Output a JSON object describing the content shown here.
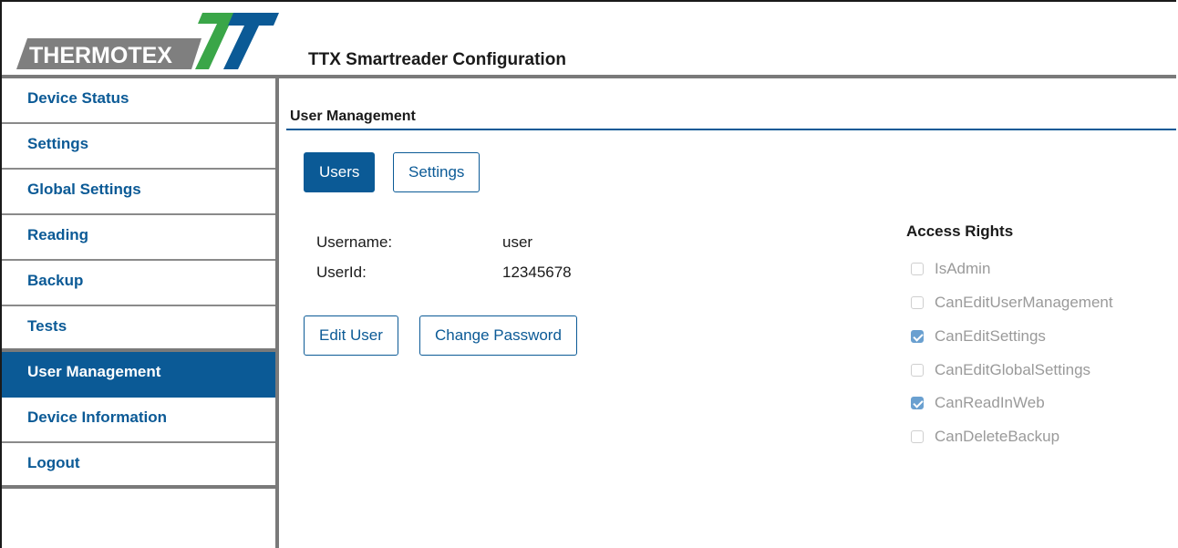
{
  "header": {
    "logo_text": "THERMOTEX",
    "app_title": "TTX Smartreader Configuration"
  },
  "sidebar": {
    "items": [
      {
        "label": "Device Status",
        "active": false
      },
      {
        "label": "Settings",
        "active": false
      },
      {
        "label": "Global Settings",
        "active": false
      },
      {
        "label": "Reading",
        "active": false
      },
      {
        "label": "Backup",
        "active": false
      },
      {
        "label": "Tests",
        "active": false
      },
      {
        "label": "User Management",
        "active": true
      },
      {
        "label": "Device Information",
        "active": false
      },
      {
        "label": "Logout",
        "active": false
      }
    ]
  },
  "main": {
    "section_title": "User Management",
    "tabs": [
      {
        "label": "Users",
        "active": true
      },
      {
        "label": "Settings",
        "active": false
      }
    ],
    "user": {
      "username_label": "Username:",
      "username_value": "user",
      "userid_label": "UserId:",
      "userid_value": "12345678"
    },
    "actions": {
      "edit_user": "Edit User",
      "change_password": "Change Password"
    },
    "access_rights": {
      "title": "Access Rights",
      "items": [
        {
          "label": "IsAdmin",
          "checked": false
        },
        {
          "label": "CanEditUserManagement",
          "checked": false
        },
        {
          "label": "CanEditSettings",
          "checked": true
        },
        {
          "label": "CanEditGlobalSettings",
          "checked": false
        },
        {
          "label": "CanReadInWeb",
          "checked": true
        },
        {
          "label": "CanDeleteBackup",
          "checked": false
        }
      ]
    }
  },
  "colors": {
    "brand_blue": "#0b5a96",
    "logo_green": "#3aa648",
    "logo_gray": "#7f7f7f",
    "checkbox_checked": "#6aa0d0",
    "disabled_text": "#9a9a9a"
  }
}
